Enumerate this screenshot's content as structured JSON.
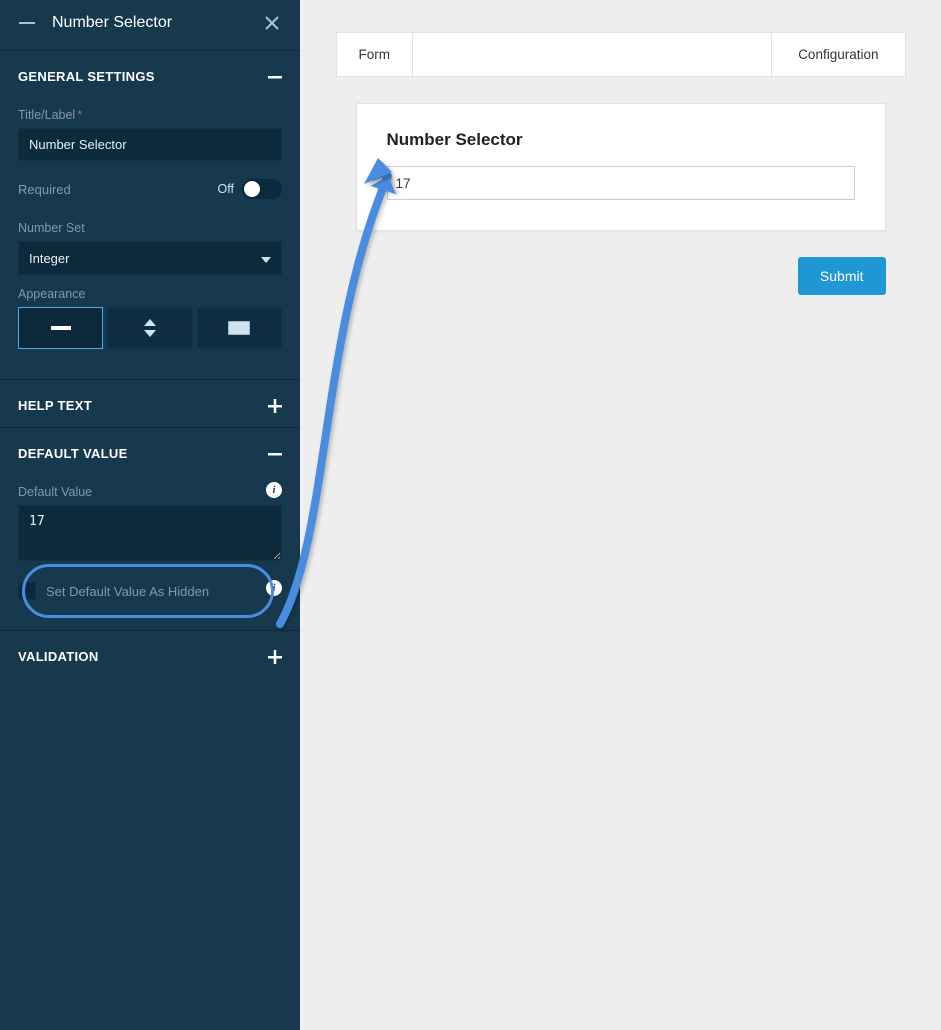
{
  "sidebar": {
    "title": "Number Selector",
    "sections": {
      "general": {
        "title": "GENERAL SETTINGS",
        "title_label": "Title/Label",
        "title_value": "Number Selector",
        "required_label": "Required",
        "required_state": "Off",
        "numberset_label": "Number Set",
        "numberset_value": "Integer",
        "appearance_label": "Appearance"
      },
      "helptext": {
        "title": "HELP TEXT"
      },
      "defaultvalue": {
        "title": "DEFAULT VALUE",
        "default_label": "Default Value",
        "default_value": "17",
        "hidden_label": "Set Default Value As Hidden"
      },
      "validation": {
        "title": "VALIDATION"
      }
    }
  },
  "main": {
    "tabs": {
      "form": "Form",
      "configuration": "Configuration"
    },
    "preview": {
      "title": "Number Selector",
      "value": "17"
    },
    "submit": "Submit"
  }
}
